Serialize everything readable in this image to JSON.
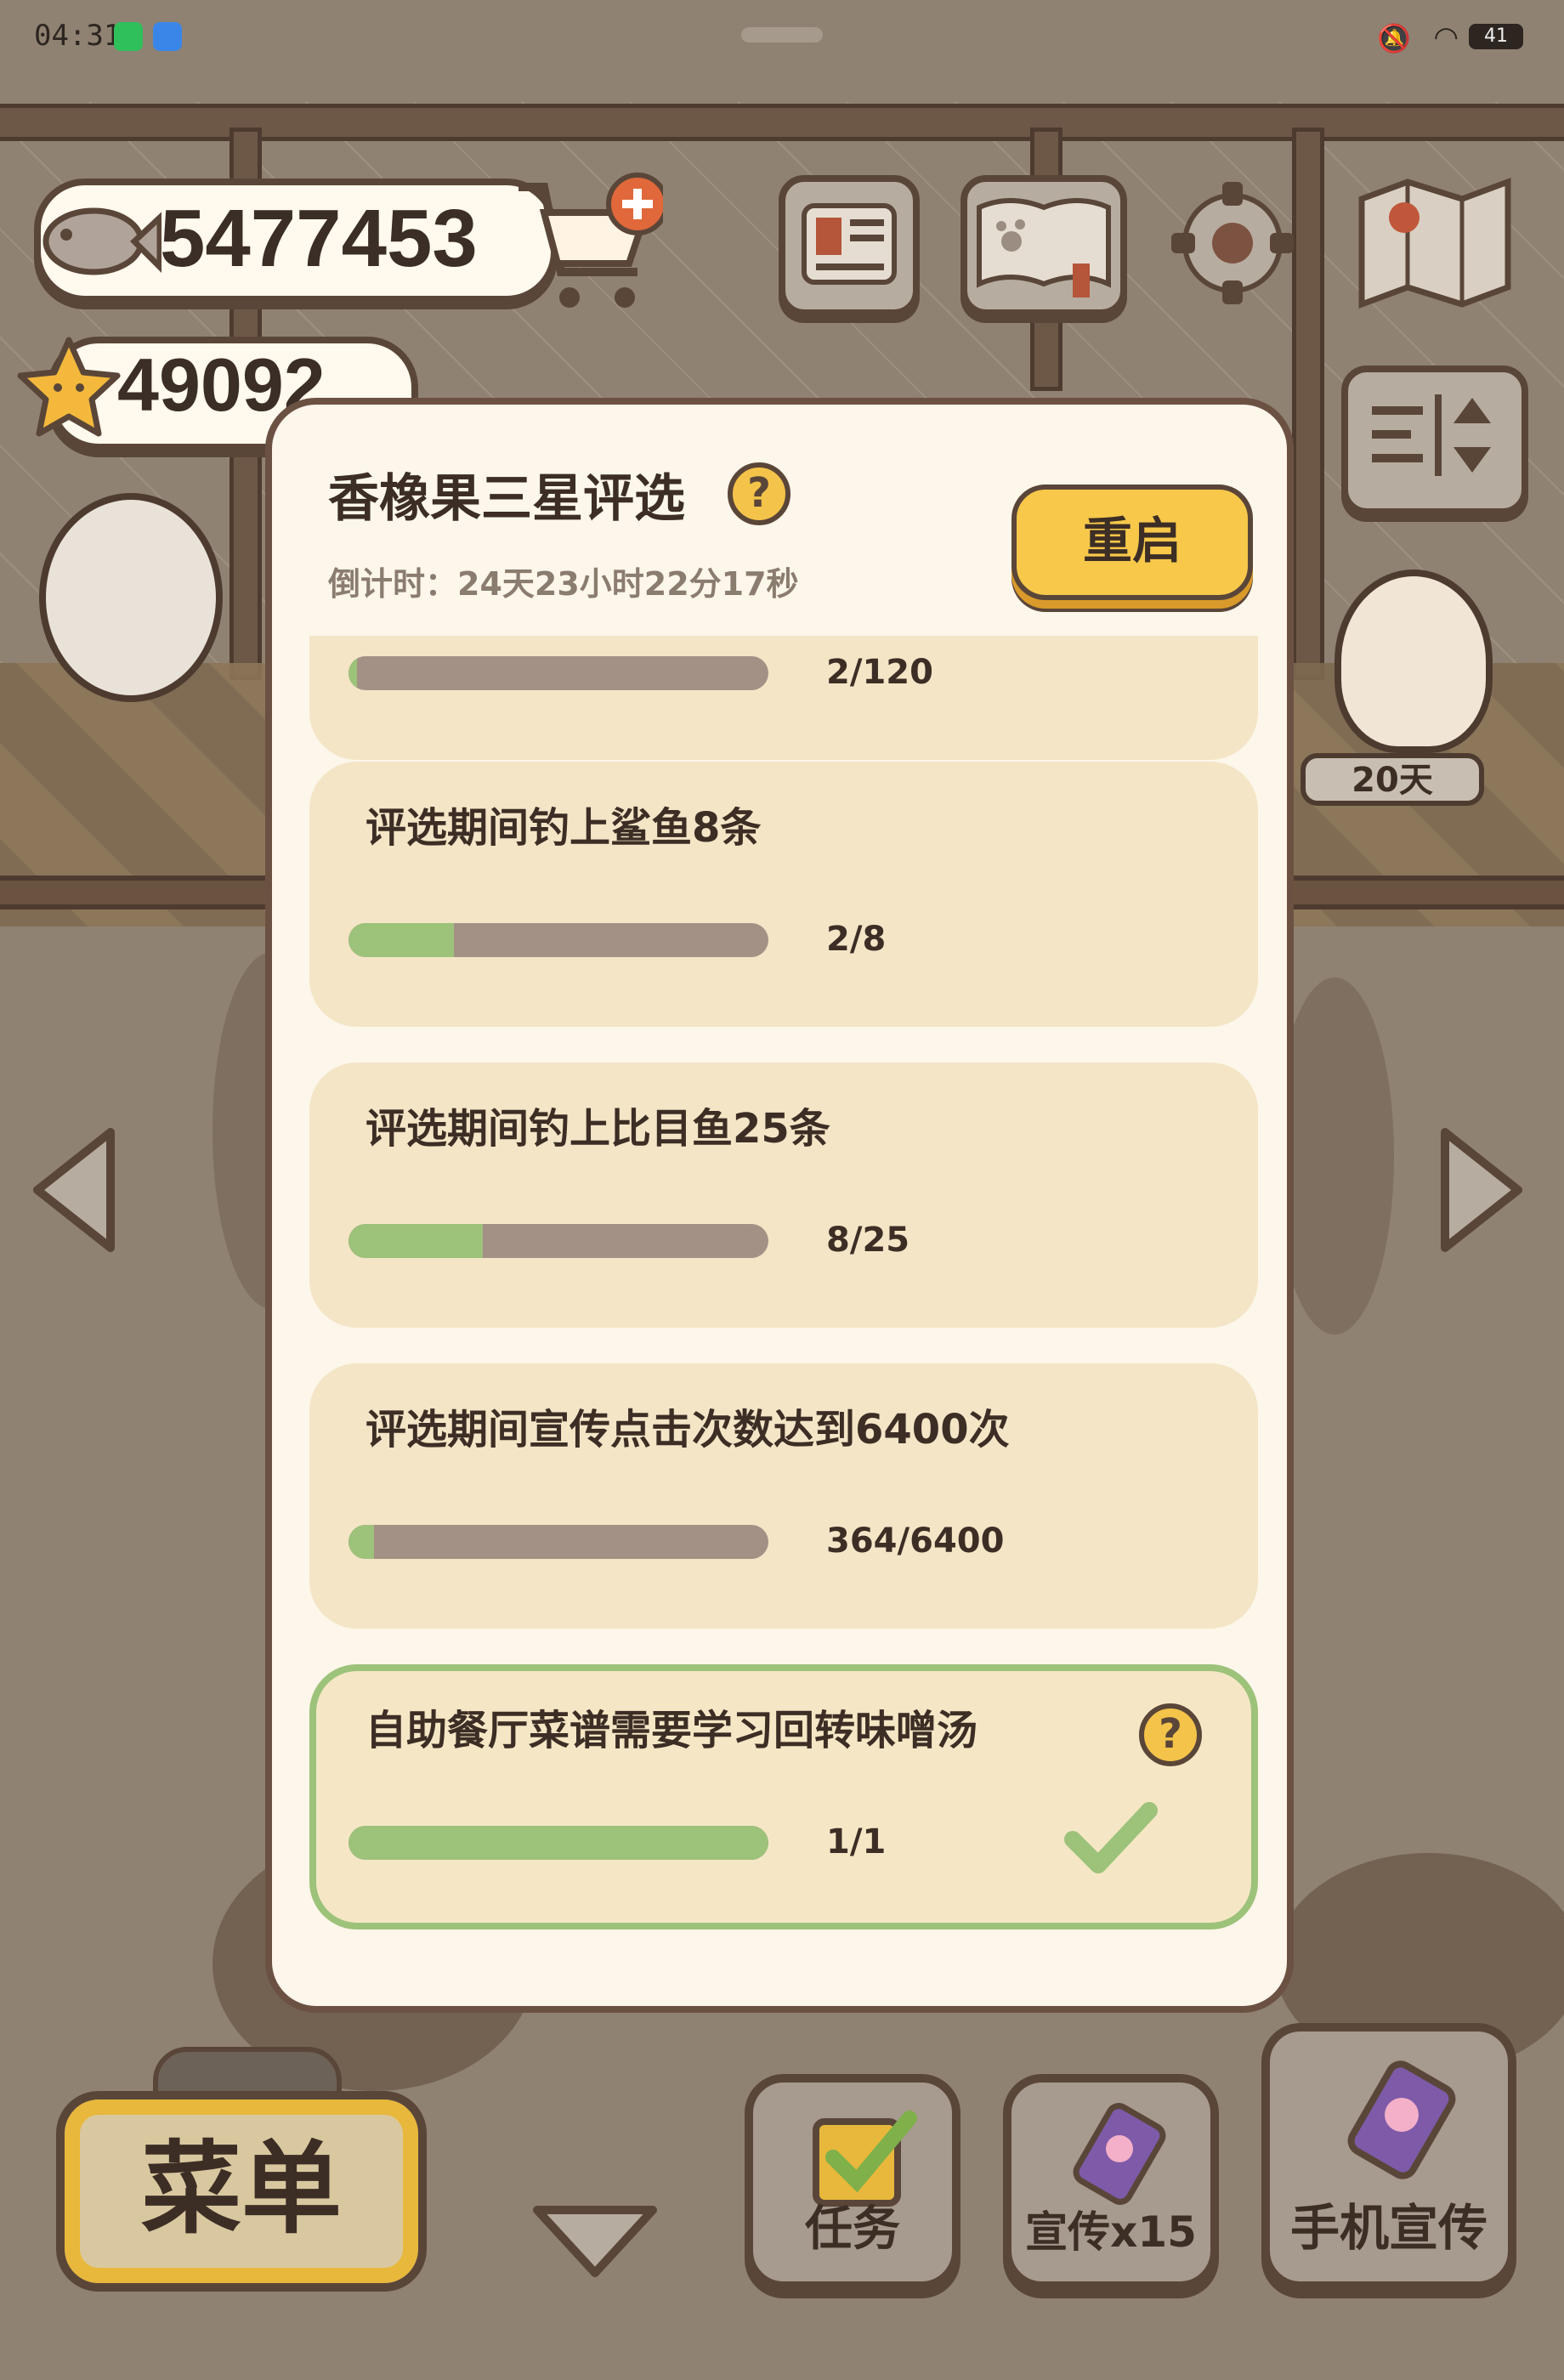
{
  "status_bar": {
    "time": "04:31",
    "battery": "41"
  },
  "currency": {
    "fish": "5477453",
    "stars": "49092"
  },
  "character_tag": "20天",
  "panel": {
    "title": "香橡果三星评选",
    "help": "?",
    "countdown": "倒计时：24天23小时22分17秒",
    "restart_label": "重启",
    "tasks": [
      {
        "title": "",
        "progress": "2/120",
        "fraction": 0.017,
        "completed": false
      },
      {
        "title": "评选期间钓上鲨鱼8条",
        "progress": "2/8",
        "fraction": 0.25,
        "completed": false
      },
      {
        "title": "评选期间钓上比目鱼25条",
        "progress": "8/25",
        "fraction": 0.32,
        "completed": false
      },
      {
        "title": "评选期间宣传点击次数达到6400次",
        "progress": "364/6400",
        "fraction": 0.057,
        "completed": false
      },
      {
        "title": "自助餐厅菜谱需要学习回转味噌汤",
        "progress": "1/1",
        "fraction": 1.0,
        "completed": true
      }
    ]
  },
  "bottom": {
    "menu_label": "菜单",
    "tasks_label": "任务",
    "promote_label": "宣传x15",
    "phone_promote_label": "手机宣传"
  },
  "colors": {
    "accent_yellow": "#f7c84a",
    "progress_green": "#9dc27a",
    "outline": "#5a4638"
  },
  "icons": [
    "fish-icon",
    "cart-plus-icon",
    "star-icon",
    "newspaper-icon",
    "pawbook-icon",
    "gear-icon",
    "map-icon",
    "sort-icon",
    "left-arrow-icon",
    "right-arrow-icon",
    "check-icon",
    "down-arrow-icon",
    "phone-icon"
  ]
}
